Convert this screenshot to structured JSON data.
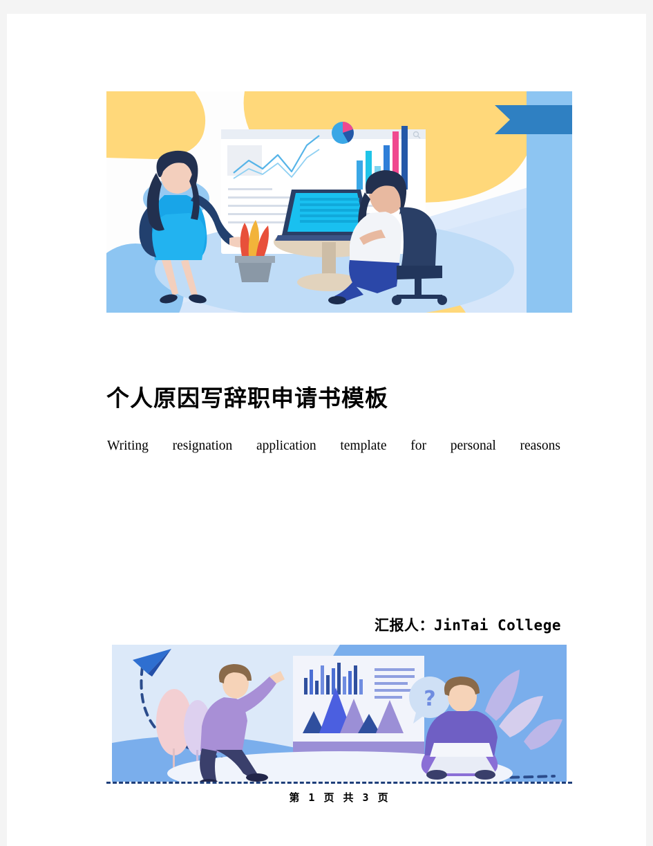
{
  "document": {
    "title": "个人原因写辞职申请书模板",
    "subtitle": "Writing resignation application template for personal reasons",
    "author_line": "汇报人：JinTai  College",
    "footer_pager": "第 1 页 共 3 页"
  },
  "hero_illustration": {
    "name": "business-teamwork-dashboard-illustration",
    "description": "Two women at a desk with a laptop in front of a large analytics dashboard screen",
    "elements": [
      "yellow-blob-top-left",
      "light-blue-ellipse",
      "pale-blue-diagonal-band",
      "blue-circle-bottom-left",
      "yellow-blob-top-right",
      "blue-ribbon-banner",
      "dashboard-screen",
      "line-chart",
      "pie-chart",
      "bar-chart",
      "standing-woman",
      "seated-woman",
      "laptop",
      "round-table",
      "potted-plant",
      "office-chair"
    ],
    "colors": {
      "yellow": "#ffd978",
      "pale_blue": "#d6e8fa",
      "light_blue": "#92c9f5",
      "mid_blue": "#2f9fe0",
      "ribbon_blue": "#2f80c2",
      "navy": "#25385f",
      "dress_blue": "#18a5e8",
      "pink": "#f0488f",
      "background": "#fdfdfd"
    }
  },
  "footer_illustration": {
    "name": "presentation-and-learning-illustration",
    "description": "Paper plane with dashed flight path, a man pointing at a chart board, and a man sitting cross-legged with a laptop",
    "elements": [
      "paper-airplane",
      "dashed-flight-path",
      "blue-wave",
      "presentation-board",
      "bar-chart",
      "mountain-chart",
      "text-lines",
      "pointing-man",
      "seated-man-with-laptop",
      "question-mark-bubble",
      "leaf-plant"
    ],
    "colors": {
      "sky": "#dce9f9",
      "wave": "#78aeec",
      "plane": "#2f6fd0",
      "dash": "#2b4c8c",
      "purple": "#9b8fd6",
      "violet": "#6f5fc4",
      "navy": "#3a3f6b",
      "board": "#f2f4fb",
      "skin": "#f6d3b8",
      "leaf_pink": "#f3cfd2"
    }
  },
  "theme": {
    "page_background": "#ffffff",
    "viewer_background": "#f4f4f4",
    "text_color": "#000000",
    "rule_color": "#1f3f7a"
  }
}
